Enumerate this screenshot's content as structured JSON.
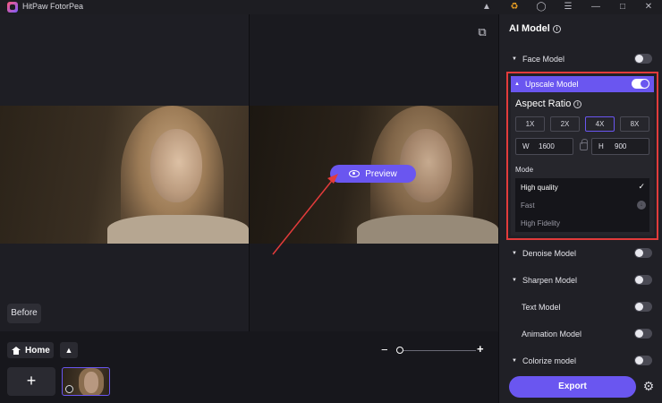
{
  "app": {
    "title": "HitPaw FotorPea"
  },
  "titlebar_icons": [
    "discord-icon",
    "cart-icon",
    "account-icon",
    "menu-icon",
    "minimize-icon",
    "maximize-icon",
    "close-icon"
  ],
  "canvas": {
    "preview_label": "Preview",
    "before_label": "Before"
  },
  "bottom": {
    "home_label": "Home",
    "add_symbol": "+",
    "zoom_minus": "−",
    "zoom_plus": "+"
  },
  "sidebar": {
    "title": "AI Model",
    "face_model": "Face Model",
    "upscale": {
      "title": "Upscale Model",
      "aspect_ratio_title": "Aspect Ratio",
      "ratios": [
        "1X",
        "2X",
        "4X",
        "8X"
      ],
      "active_ratio": "4X",
      "width_key": "W",
      "width_value": "1600",
      "height_key": "H",
      "height_value": "900",
      "mode_label": "Mode",
      "modes": [
        "High quality",
        "Fast",
        "High Fidelity"
      ],
      "selected_mode": "High quality"
    },
    "denoise_model": "Denoise Model",
    "sharpen_model": "Sharpen Model",
    "text_model": "Text Model",
    "animation_model": "Animation Model",
    "colorize_model": "Colorize model",
    "export_label": "Export"
  },
  "colors": {
    "accent": "#6a56f0",
    "highlight_border": "#e23b3b",
    "annotation_arrow": "#e23b3b"
  }
}
